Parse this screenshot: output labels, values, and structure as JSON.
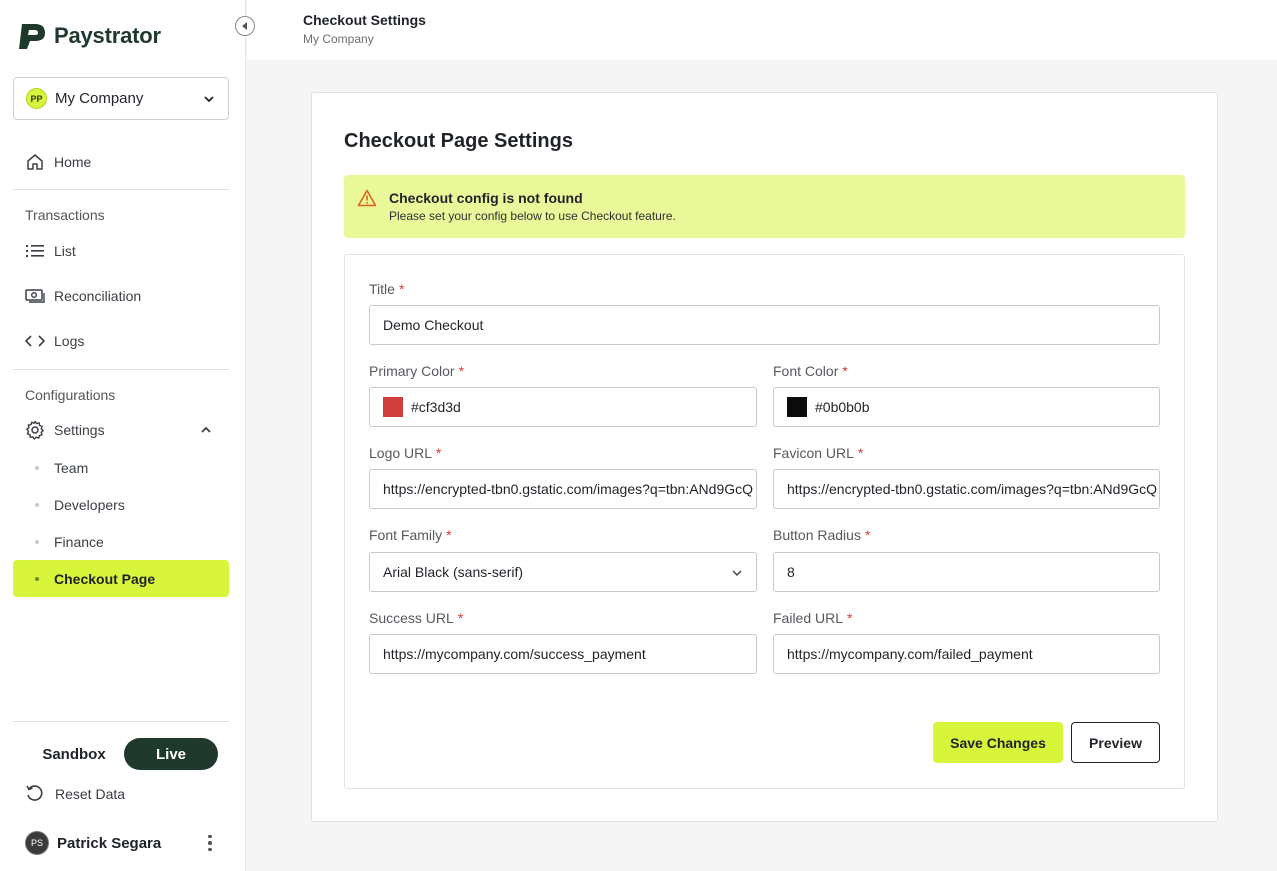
{
  "app": {
    "name": "Paystrator"
  },
  "company_selector": {
    "initials": "PP",
    "name": "My Company"
  },
  "sidebar": {
    "home": "Home",
    "transactions_label": "Transactions",
    "transactions": [
      "List",
      "Reconciliation",
      "Logs"
    ],
    "configurations_label": "Configurations",
    "settings": "Settings",
    "settings_items": [
      "Team",
      "Developers",
      "Finance",
      "Checkout Page"
    ],
    "active_item": "Checkout Page",
    "env": {
      "sandbox": "Sandbox",
      "live": "Live",
      "selected": "Live"
    },
    "reset": "Reset Data",
    "user": {
      "initials": "PS",
      "name": "Patrick Segara"
    }
  },
  "header": {
    "title": "Checkout Settings",
    "subtitle": "My Company"
  },
  "card": {
    "title": "Checkout Page Settings",
    "alert": {
      "title": "Checkout config is not found",
      "message": "Please set your config below to use Checkout feature."
    }
  },
  "form": {
    "title": {
      "label": "Title",
      "value": "Demo Checkout"
    },
    "primary_color": {
      "label": "Primary Color",
      "value": "#cf3d3d"
    },
    "font_color": {
      "label": "Font Color",
      "value": "#0b0b0b"
    },
    "logo_url": {
      "label": "Logo URL",
      "value": "https://encrypted-tbn0.gstatic.com/images?q=tbn:ANd9GcQ"
    },
    "favicon_url": {
      "label": "Favicon URL",
      "value": "https://encrypted-tbn0.gstatic.com/images?q=tbn:ANd9GcQ"
    },
    "font_family": {
      "label": "Font Family",
      "value": "Arial Black (sans-serif)"
    },
    "button_radius": {
      "label": "Button Radius",
      "value": "8"
    },
    "success_url": {
      "label": "Success URL",
      "value": "https://mycompany.com/success_payment"
    },
    "failed_url": {
      "label": "Failed URL",
      "value": "https://mycompany.com/failed_payment"
    },
    "required_mark": "*"
  },
  "buttons": {
    "save": "Save Changes",
    "preview": "Preview"
  },
  "colors": {
    "accent": "#d8f53c",
    "brand_dark": "#1f3a2c",
    "alert_bg": "#e9f898",
    "required": "#d43a3a"
  }
}
